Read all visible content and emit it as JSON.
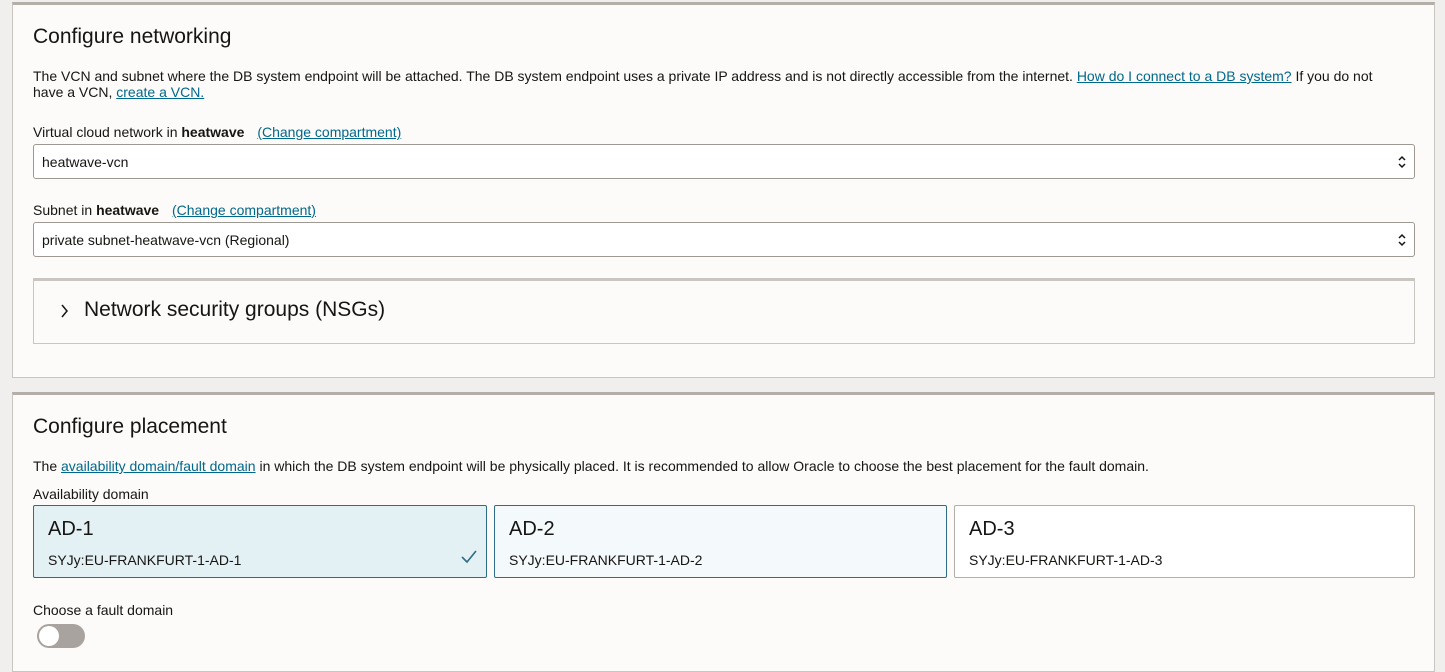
{
  "networking": {
    "title": "Configure networking",
    "desc_text": "The VCN and subnet where the DB system endpoint will be attached. The DB system endpoint uses a private IP address and is not directly accessible from the internet.",
    "desc_link": "How do I connect to a DB system?",
    "desc_text2": "If you do not have a VCN,",
    "desc_link2": "create a VCN.",
    "vcn": {
      "label_prefix": "Virtual cloud network in",
      "compartment": "heatwave",
      "change_link": "(Change compartment)",
      "value": "heatwave-vcn"
    },
    "subnet": {
      "label_prefix": "Subnet in",
      "compartment": "heatwave",
      "change_link": "(Change compartment)",
      "value": "private subnet-heatwave-vcn (Regional)"
    },
    "nsg": {
      "title": "Network security groups (NSGs)",
      "icon": "chevron-right-icon"
    }
  },
  "placement": {
    "title": "Configure placement",
    "desc_prefix": "The",
    "desc_link": "availability domain/fault domain",
    "desc_suffix": "in which the DB system endpoint will be physically placed. It is recommended to allow Oracle to choose the best placement for the fault domain.",
    "ad_label": "Availability domain",
    "ads": [
      {
        "name": "AD-1",
        "id": "SYJy:EU-FRANKFURT-1-AD-1",
        "selected": true
      },
      {
        "name": "AD-2",
        "id": "SYJy:EU-FRANKFURT-1-AD-2",
        "selected": false
      },
      {
        "name": "AD-3",
        "id": "SYJy:EU-FRANKFURT-1-AD-3",
        "selected": false
      }
    ],
    "fault_label": "Choose a fault domain",
    "fault_toggle_on": false
  },
  "colors": {
    "link": "#00688c",
    "selected_bg": "#e4f1f4",
    "selected_border": "#2e6d84"
  }
}
